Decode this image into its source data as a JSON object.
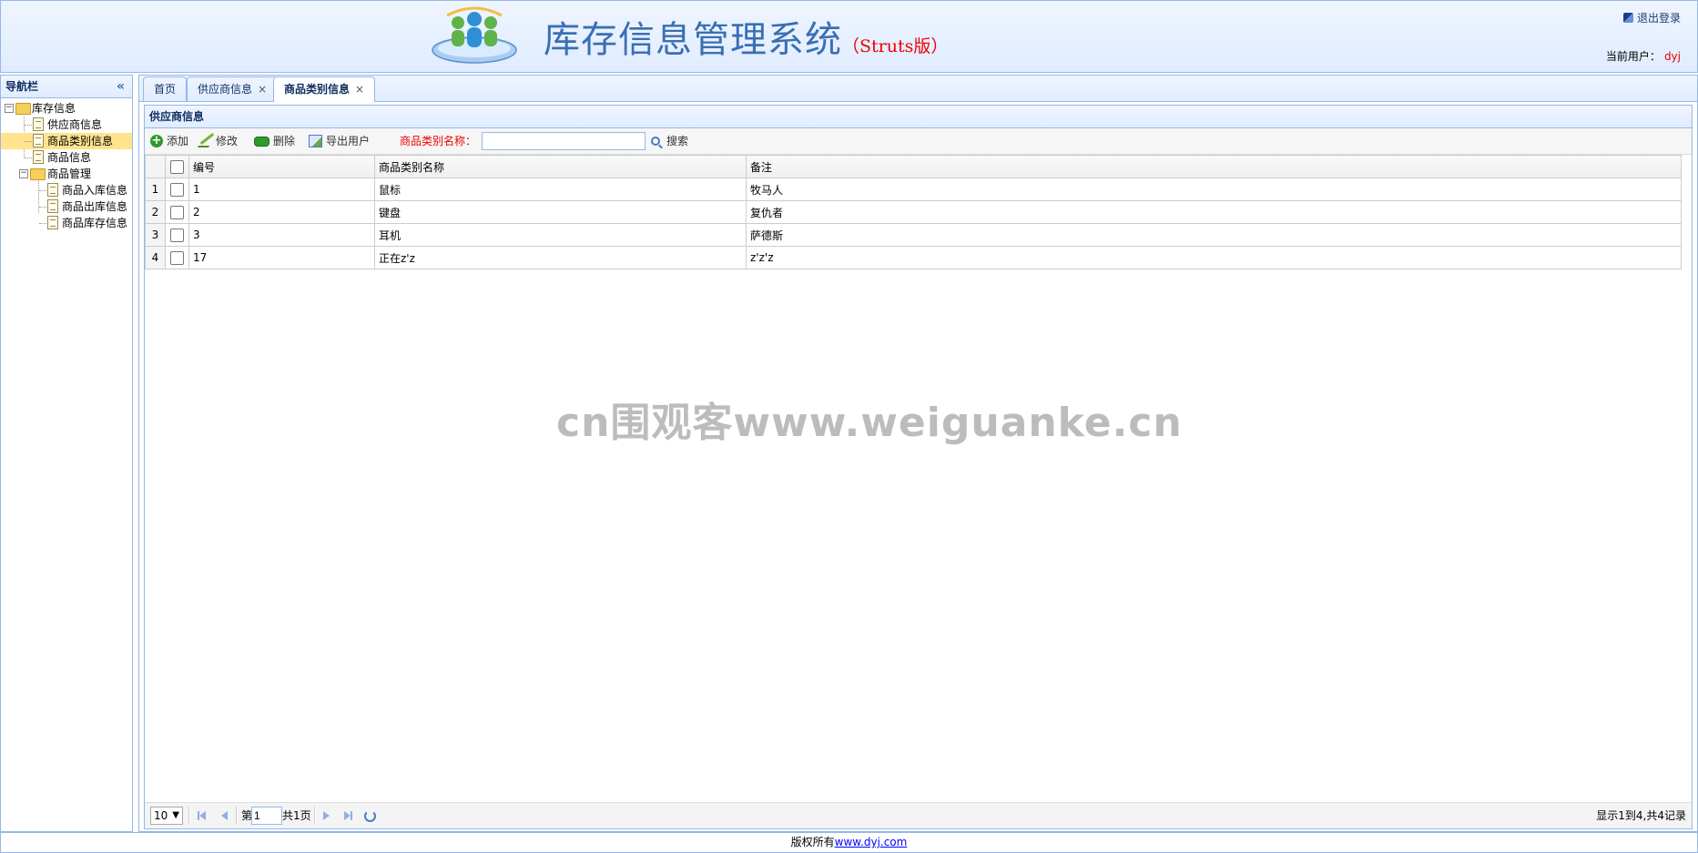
{
  "header": {
    "title": "库存信息管理系统",
    "subtitle": "（Struts版）",
    "logout_label": "退出登录",
    "current_user_label": "当前用户：",
    "current_user": "dyj"
  },
  "nav": {
    "title": "导航栏",
    "collapse_glyph": "«",
    "tree": [
      {
        "label": "库存信息"
      },
      {
        "label": "供应商信息"
      },
      {
        "label": "商品类别信息"
      },
      {
        "label": "商品信息"
      },
      {
        "label": "商品管理"
      },
      {
        "label": "商品入库信息"
      },
      {
        "label": "商品出库信息"
      },
      {
        "label": "商品库存信息"
      }
    ]
  },
  "tabs": [
    {
      "label": "首页"
    },
    {
      "label": "供应商信息",
      "close": "×"
    },
    {
      "label": "商品类别信息",
      "close": "×"
    }
  ],
  "panel": {
    "title": "供应商信息",
    "toolbar": {
      "add": "添加",
      "edit": "修改",
      "delete": "删除",
      "export": "导出用户",
      "search_label": "商品类别名称：",
      "search_value": "",
      "search_button": "搜索"
    },
    "columns": [
      "编号",
      "商品类别名称",
      "备注"
    ],
    "rows": [
      {
        "rn": "1",
        "id": "1",
        "name": "鼠标",
        "note": "牧马人"
      },
      {
        "rn": "2",
        "id": "2",
        "name": "键盘",
        "note": "复仇者"
      },
      {
        "rn": "3",
        "id": "3",
        "name": "耳机",
        "note": "萨德斯"
      },
      {
        "rn": "4",
        "id": "17",
        "name": "正在z'z",
        "note": "z'z'z"
      }
    ],
    "pager": {
      "page_size": "10",
      "page_prefix": "第",
      "page_value": "1",
      "page_total": "共1页",
      "summary": "显示1到4,共4记录"
    }
  },
  "watermark": "cn围观客www.weiguanke.cn",
  "footer": {
    "text": "版权所有",
    "link": "www.dyj.com"
  },
  "colors": {
    "accent_border": "#95b8e7",
    "title_blue": "#3a6fb3",
    "red": "#e00000",
    "selected_row": "#ffe48d"
  }
}
